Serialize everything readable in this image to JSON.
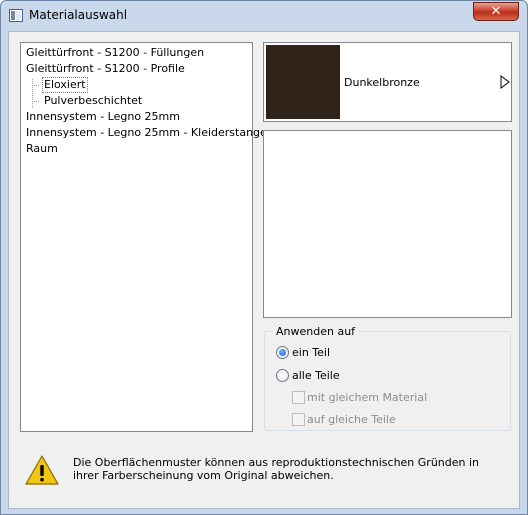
{
  "window": {
    "title": "Materialauswahl",
    "close_glyph": "✕",
    "icon": "window-app-icon"
  },
  "tree": {
    "items": [
      {
        "label": "Gleittürfront - S1200 - Füllungen",
        "level": 0
      },
      {
        "label": "Gleittürfront - S1200 - Profile",
        "level": 0
      },
      {
        "label": "Eloxiert",
        "level": 1,
        "selected": true
      },
      {
        "label": "Pulverbeschichtet",
        "level": 1
      },
      {
        "label": "Innensystem - Legno 25mm",
        "level": 0
      },
      {
        "label": "Innensystem - Legno 25mm - Kleiderstange",
        "level": 0
      },
      {
        "label": "Raum",
        "level": 0
      }
    ]
  },
  "material": {
    "name": "Dunkelbronze",
    "swatch_color": "#2f231a",
    "arrow_icon": "triangle-right-icon"
  },
  "apply_to": {
    "legend": "Anwenden auf",
    "options": [
      {
        "label": "ein Teil",
        "checked": true
      },
      {
        "label": "alle Teile",
        "checked": false
      }
    ],
    "suboptions": [
      {
        "label": "mit gleichem Material",
        "checked": false,
        "enabled": false
      },
      {
        "label": "auf gleiche Teile",
        "checked": false,
        "enabled": false
      }
    ]
  },
  "notice": {
    "icon": "warning-icon",
    "text": "Die Oberflächenmuster können aus reproduktionstechnischen Gründen in ihrer Farberscheinung vom Original abweichen."
  },
  "colors": {
    "accent": "#1a5fc4",
    "close_button": "#c8412b",
    "warning": "#f2c511"
  }
}
